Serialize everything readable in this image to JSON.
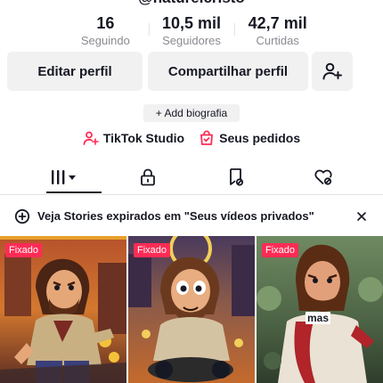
{
  "profile": {
    "username": "@naturelcristo"
  },
  "stats": [
    {
      "value": "16",
      "label": "Seguindo"
    },
    {
      "value": "10,5 mil",
      "label": "Seguidores"
    },
    {
      "value": "42,7 mil",
      "label": "Curtidas"
    }
  ],
  "actions": {
    "edit_label": "Editar perfil",
    "share_label": "Compartilhar perfil",
    "add_friend_icon": "add-person-icon"
  },
  "bio": {
    "add_label": "+ Add biografia"
  },
  "links": {
    "studio_label": "TikTok Studio",
    "studio_icon": "person-sparkle-icon",
    "orders_label": "Seus pedidos",
    "orders_icon": "bag-check-icon",
    "accent": "#fe2c55"
  },
  "tabs": [
    {
      "icon": "grid-icon",
      "active": true
    },
    {
      "icon": "lock-icon",
      "active": false
    },
    {
      "icon": "bookmark-icon",
      "active": false
    },
    {
      "icon": "heart-hidden-icon",
      "active": false
    }
  ],
  "banner": {
    "text": "Veja Stories expirados em \"Seus vídeos privados\"",
    "close_icon": "close-icon"
  },
  "videos": [
    {
      "badge": "Fixado",
      "caption": ""
    },
    {
      "badge": "Fixado",
      "caption": ""
    },
    {
      "badge": "Fixado",
      "caption": "mas"
    }
  ]
}
